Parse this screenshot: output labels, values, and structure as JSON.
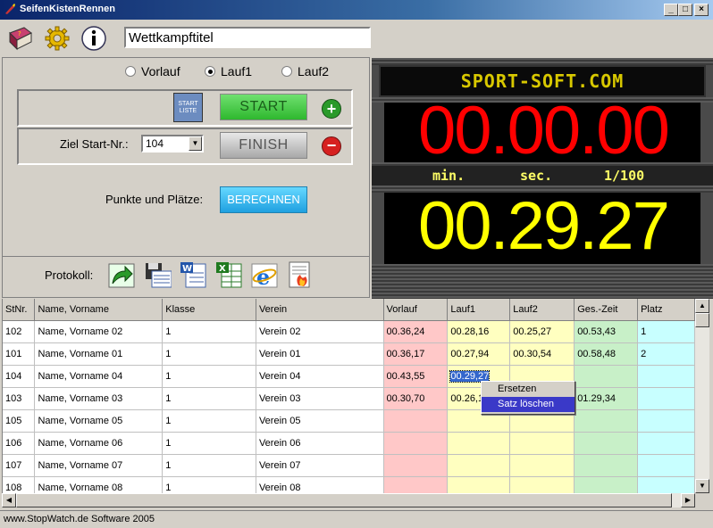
{
  "window": {
    "title": "SeifenKistenRennen",
    "min": "_",
    "max": "□",
    "close": "×"
  },
  "toolbar": {
    "title_value": "Wettkampftitel",
    "help_icon": "help-book-icon",
    "settings_icon": "gear-icon",
    "info_icon": "info-icon"
  },
  "run_selector": {
    "options": [
      "Vorlauf",
      "Lauf1",
      "Lauf2"
    ],
    "selected": "Lauf1"
  },
  "controls": {
    "startliste_label": "START\nLISTE",
    "start_label": "START",
    "finish_label": "FINISH",
    "ziel_label": "Ziel Start-Nr.:",
    "ziel_value": "104",
    "punkte_label": "Punkte und Plätze:",
    "berechnen_label": "BERECHNEN"
  },
  "protokoll": {
    "label": "Protokoll:",
    "icons": [
      "export-arrow-icon",
      "save-disk-icon",
      "word-doc-icon",
      "excel-icon",
      "internet-explorer-icon",
      "print-preview-icon"
    ]
  },
  "board": {
    "brand": "SPORT-SOFT.COM",
    "running_time": "00.00.00",
    "unit_min": "min.",
    "unit_sec": "sec.",
    "unit_hundredth": "1/100",
    "last_time": "00.29.27",
    "colors": {
      "running": "#ff0000",
      "last": "#ffff00",
      "brand": "#d8c800",
      "units": "#ffff66"
    }
  },
  "table": {
    "columns": [
      "StNr.",
      "Name, Vorname",
      "Klasse",
      "Verein",
      "Vorlauf",
      "Lauf1",
      "Lauf2",
      "Ges.-Zeit",
      "Platz"
    ],
    "rows": [
      [
        "102",
        "Name, Vorname 02",
        "1",
        "Verein 02",
        "00.36,24",
        "00.28,16",
        "00.25,27",
        "00.53,43",
        "1"
      ],
      [
        "101",
        "Name, Vorname 01",
        "1",
        "Verein 01",
        "00.36,17",
        "00.27,94",
        "00.30,54",
        "00.58,48",
        "2"
      ],
      [
        "104",
        "Name, Vorname 04",
        "1",
        "Verein 04",
        "00.43,55",
        "00.29,27",
        "",
        "",
        ""
      ],
      [
        "103",
        "Name, Vorname 03",
        "1",
        "Verein 03",
        "00.30,70",
        "00.26,1",
        "",
        "01.29,34",
        ""
      ],
      [
        "105",
        "Name, Vorname 05",
        "1",
        "Verein 05",
        "",
        "",
        "",
        "",
        ""
      ],
      [
        "106",
        "Name, Vorname 06",
        "1",
        "Verein 06",
        "",
        "",
        "",
        "",
        ""
      ],
      [
        "107",
        "Name, Vorname 07",
        "1",
        "Verein 07",
        "",
        "",
        "",
        "",
        ""
      ],
      [
        "108",
        "Name, Vorname 08",
        "1",
        "Verein 08",
        "",
        "",
        "",
        "",
        ""
      ]
    ],
    "selected_cell": {
      "row": 2,
      "col": 5
    },
    "column_colors": {
      "vorlauf": "#ffc8c8",
      "lauf": "#ffffc0",
      "gesamt": "#c8f0c8",
      "platz": "#c8ffff"
    }
  },
  "context_menu": {
    "items": [
      "Ersetzen",
      "Satz löschen"
    ],
    "highlighted": "Satz löschen"
  },
  "statusbar": {
    "text": "www.StopWatch.de Software 2005"
  }
}
